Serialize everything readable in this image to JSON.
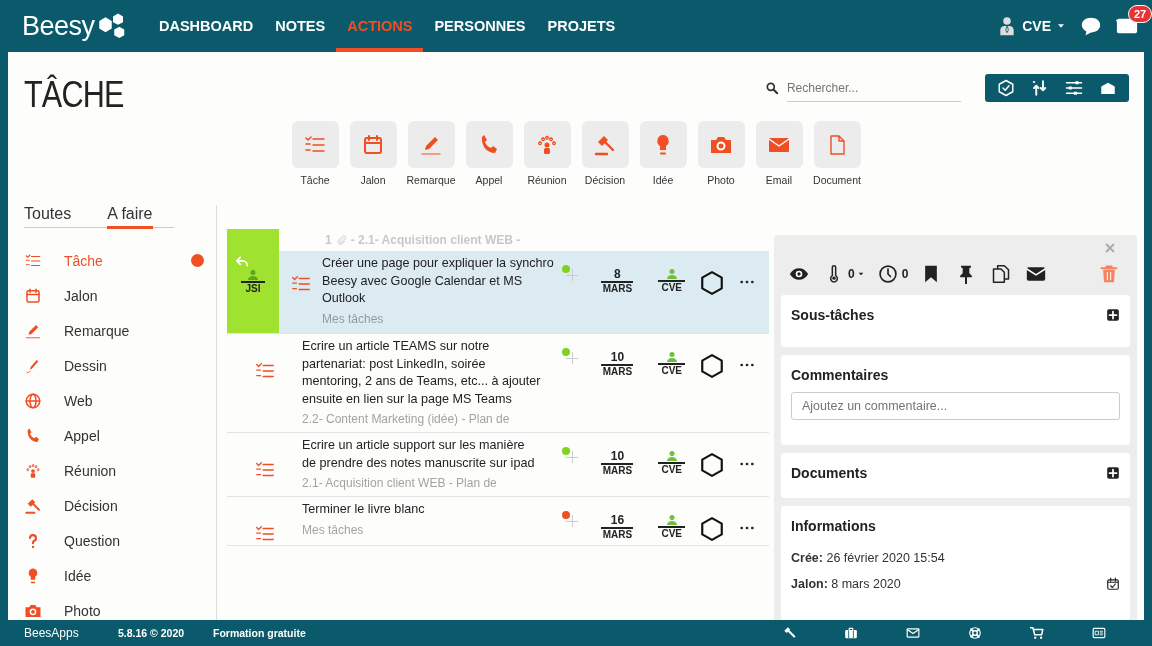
{
  "nav": {
    "logo": "Beesy",
    "items": [
      {
        "label": "DASHBOARD",
        "selected": false
      },
      {
        "label": "NOTES",
        "selected": false
      },
      {
        "label": "ACTIONS",
        "selected": true
      },
      {
        "label": "PERSONNES",
        "selected": false
      },
      {
        "label": "PROJETS",
        "selected": false
      }
    ],
    "user": "CVE",
    "mail_badge": "27"
  },
  "page": {
    "title": "TÂCHE",
    "search_placeholder": "Rechercher..."
  },
  "types": [
    {
      "label": "Tâche",
      "kind": "task"
    },
    {
      "label": "Jalon",
      "kind": "milestone"
    },
    {
      "label": "Remarque",
      "kind": "note"
    },
    {
      "label": "Appel",
      "kind": "call"
    },
    {
      "label": "Réunion",
      "kind": "meeting"
    },
    {
      "label": "Décision",
      "kind": "decision"
    },
    {
      "label": "Idée",
      "kind": "idea"
    },
    {
      "label": "Photo",
      "kind": "photo"
    },
    {
      "label": "Email",
      "kind": "email"
    },
    {
      "label": "Document",
      "kind": "document"
    }
  ],
  "filter_tabs": [
    {
      "label": "Toutes",
      "selected": false
    },
    {
      "label": "A faire",
      "selected": true
    }
  ],
  "sidebar": [
    {
      "label": "Tâche",
      "kind": "task",
      "selected": true
    },
    {
      "label": "Jalon",
      "kind": "milestone",
      "selected": false
    },
    {
      "label": "Remarque",
      "kind": "note",
      "selected": false
    },
    {
      "label": "Dessin",
      "kind": "drawing",
      "selected": false
    },
    {
      "label": "Web",
      "kind": "web",
      "selected": false
    },
    {
      "label": "Appel",
      "kind": "call",
      "selected": false
    },
    {
      "label": "Réunion",
      "kind": "meeting",
      "selected": false
    },
    {
      "label": "Décision",
      "kind": "decision",
      "selected": false
    },
    {
      "label": "Question",
      "kind": "question",
      "selected": false
    },
    {
      "label": "Idée",
      "kind": "idea",
      "selected": false
    },
    {
      "label": "Photo",
      "kind": "photo",
      "selected": false
    }
  ],
  "group_header": {
    "count": "1",
    "title": "- 2.1- Acquisition client WEB -"
  },
  "tasks": [
    {
      "title": "Créer une page pour expliquer la synchro Beesy avec Google Calendar et MS Outlook",
      "project": "Mes tâches",
      "selected": true,
      "delegated_to": "JSI",
      "color": "#7ed321",
      "day": "8",
      "month": "MARS",
      "assignee": "CVE"
    },
    {
      "title": "Ecrire un article TEAMS sur notre partenariat: post LinkedIn, soirée mentoring, 2 ans de Teams, etc... à ajouter ensuite en lien sur la page MS Teams",
      "project": "2.2- Content Marketing (idée) - Plan de",
      "selected": false,
      "color": "#7ed321",
      "day": "10",
      "month": "MARS",
      "assignee": "CVE"
    },
    {
      "title": "Ecrire un article support sur les manière de prendre des notes manuscrite sur ipad",
      "project": "2.1- Acquisition client WEB - Plan de",
      "selected": false,
      "color": "#7ed321",
      "day": "10",
      "month": "MARS",
      "assignee": "CVE"
    },
    {
      "title": "Terminer le livre blanc",
      "project": "Mes tâches",
      "selected": false,
      "color": "#f04e23",
      "day": "16",
      "month": "MARS",
      "assignee": "CVE"
    }
  ],
  "panel": {
    "temperature": "0",
    "timer": "0",
    "subtasks_title": "Sous-tâches",
    "comments_title": "Commentaires",
    "comment_placeholder": "Ajoutez un commentaire...",
    "documents_title": "Documents",
    "info_title": "Informations",
    "info": [
      {
        "text": "**Crée:** 26 février 2020 15:54",
        "kind": "text"
      },
      {
        "text": "**Jalon:** 8 mars 2020",
        "kind": "date"
      }
    ]
  },
  "footer": {
    "logo": "BeesApps",
    "version": "5.8.16 © 2020",
    "link": "Formation gratuite"
  }
}
